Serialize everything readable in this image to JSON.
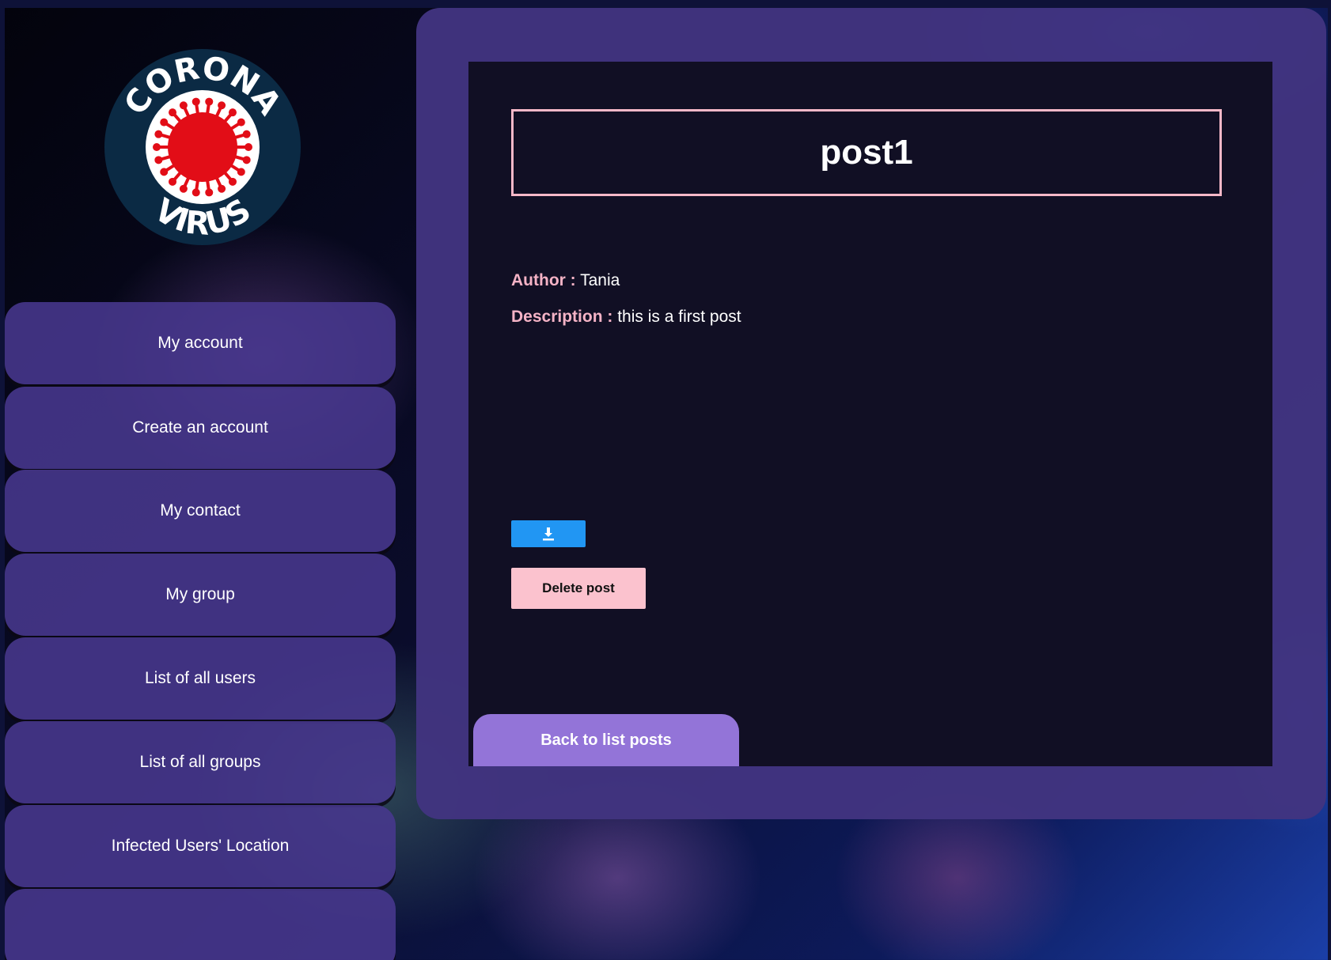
{
  "logo": {
    "text_top": "CORONA",
    "text_bottom": "VIRUS",
    "ring_color": "#0b2a44",
    "virus_color": "#e20d17"
  },
  "sidebar": {
    "items": [
      {
        "label": "My account"
      },
      {
        "label": "Create an account"
      },
      {
        "label": "My contact"
      },
      {
        "label": "My group"
      },
      {
        "label": "List of all users"
      },
      {
        "label": "List of all groups"
      },
      {
        "label": "Infected Users' Location"
      }
    ]
  },
  "post": {
    "title": "post1",
    "author_label": "Author :",
    "author": "Tania",
    "description_label": "Description :",
    "description": "this is a first post"
  },
  "actions": {
    "download_icon": "download-icon",
    "delete_label": "Delete post",
    "back_label": "Back to list posts"
  },
  "colors": {
    "panel": "#42347f",
    "card": "#110f24",
    "accent_pink": "#f5b3c6",
    "download_blue": "#2196f3",
    "back_purple": "#9374d8"
  }
}
